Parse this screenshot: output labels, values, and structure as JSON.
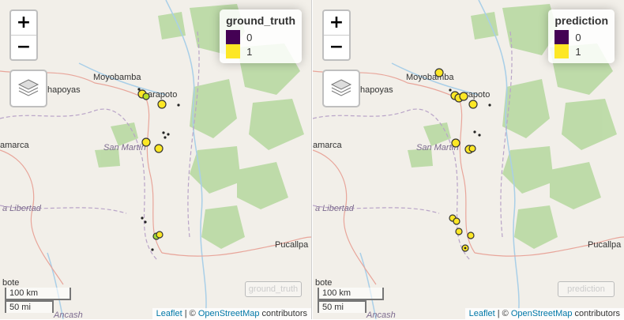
{
  "left": {
    "legend": {
      "title": "ground_truth",
      "items": [
        {
          "label": "0",
          "color": "#440154"
        },
        {
          "label": "1",
          "color": "#fde725"
        }
      ]
    },
    "watermark": "ground_truth"
  },
  "right": {
    "legend": {
      "title": "prediction",
      "items": [
        {
          "label": "0",
          "color": "#440154"
        },
        {
          "label": "1",
          "color": "#fde725"
        }
      ]
    },
    "watermark": "prediction"
  },
  "map": {
    "zoom_in": "+",
    "zoom_out": "−",
    "places": {
      "moyobamba": "Moyobamba",
      "chachapoyas": "hapoyas",
      "tarapoto": "arapoto",
      "cajamarca": "amarca",
      "san_martin": "San Martín",
      "la_libertad": "a Libertad",
      "pucallpa": "Pucallpa",
      "bote": "bote",
      "ancash": "Ancash"
    },
    "scale": {
      "km": "100 km",
      "mi": "50 mi"
    },
    "attribution": {
      "leaflet": "Leaflet",
      "sep": " | © ",
      "osm": "OpenStreetMap",
      "contributors": " contributors"
    }
  }
}
